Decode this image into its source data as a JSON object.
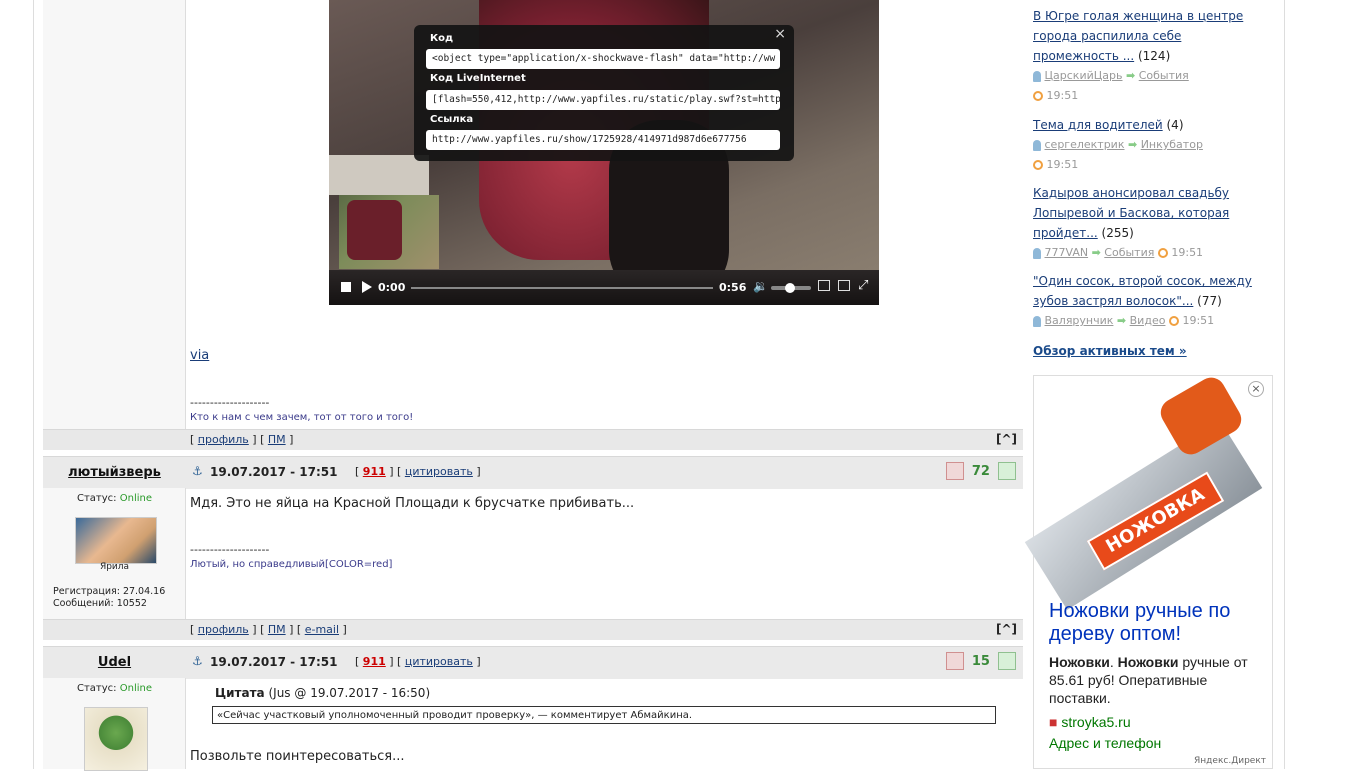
{
  "video": {
    "embed_code_label": "Код",
    "embed_code_value": "<object type=\"application/x-shockwave-flash\" data=\"http://ww",
    "embed_li_label": "Код LiveInternet",
    "embed_li_value": "[flash=550,412,http://www.yapfiles.ru/static/play.swf?st=http:",
    "embed_link_label": "Ссылка",
    "embed_link_value": "http://www.yapfiles.ru/show/1725928/414971d987d6e677756",
    "close_glyph": "×",
    "time_current": "0:00",
    "time_total": "0:56",
    "progress": 0.0
  },
  "post1": {
    "via": "via",
    "sig_divider": "--------------------",
    "signature": "Кто к нам с чем зачем, тот от того и того!",
    "footer_links": [
      "профиль",
      "ПМ"
    ],
    "top_link": "^"
  },
  "post2": {
    "author": "лютыйзверь",
    "status_label": "Статус:",
    "status_value": "Online",
    "avatar_caption": "Ярила",
    "reg_label": "Регистрация:",
    "reg_value": "27.04.16",
    "posts_label": "Сообщений:",
    "posts_value": "10552",
    "date": "19.07.2017 - 17:51",
    "report": "911",
    "quote_link": "цитировать",
    "rating": "72",
    "text": "Мдя. Это не яйца на Красной Площади к брусчатке прибивать...",
    "sig_divider": "--------------------",
    "signature": "Лютый, но справедливый[COLOR=red]",
    "footer_links": [
      "профиль",
      "ПМ",
      "e-mail"
    ],
    "top_link": "^"
  },
  "post3": {
    "author": "Udel",
    "status_label": "Статус:",
    "status_value": "Online",
    "date": "19.07.2017 - 17:51",
    "report": "911",
    "quote_link": "цитировать",
    "rating": "15",
    "quote_title": "Цитата",
    "quote_meta": "(Jus @ 19.07.2017 - 16:50)",
    "quote_text": "«Сейчас участковый уполномоченный проводит проверку», — комментирует Абмайкина.",
    "text": "Позвольте поинтересоваться..."
  },
  "sidebar": {
    "topics": [
      {
        "title": "В Югре голая женщина в центре города распилила себе промежность ...",
        "count": "(124)",
        "user": "ЦарскийЦарь",
        "forum": "События",
        "time": "19:51"
      },
      {
        "title": "Тема для водителей",
        "count": "(4)",
        "user": "сергелектрик",
        "forum": "Инкубатор",
        "time": "19:51"
      },
      {
        "title": "Кадыров анонсировал свадьбу Лопыревой и Баскова, которая пройдет...",
        "count": "(255)",
        "user": "777VAN",
        "forum": "События",
        "time": "19:51"
      },
      {
        "title": "\"Один сосок, второй сосок, между зубов застрял волосок\"...",
        "count": "(77)",
        "user": "Валярунчик",
        "forum": "Видео",
        "time": "19:51"
      }
    ],
    "overview_link": "Обзор активных тем »"
  },
  "ad": {
    "brand_text": "НОЖОВКА",
    "headline": "Ножовки ручные по дереву оптом!",
    "body_bold1": "Ножовки",
    "body_bold2": "Ножовки",
    "body_rest": "ручные от 85.61 руб! Оперативные поставки.",
    "domain": "stroyka5.ru",
    "address_link": "Адрес и телефон",
    "provider": "Яндекс.Директ",
    "close_glyph": "×"
  }
}
